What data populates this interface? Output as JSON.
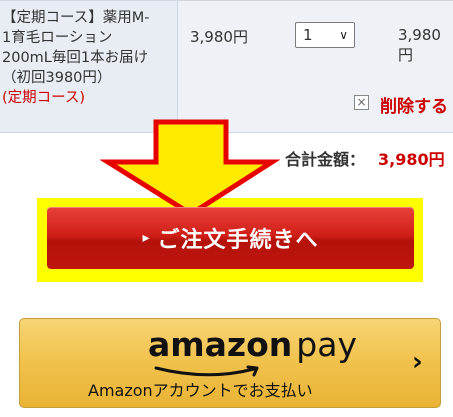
{
  "cart": {
    "item_name_lines": [
      "【定期コース】薬用M-",
      "1育毛ローション",
      "200mL毎回1本お届け",
      "（初回3980円）"
    ],
    "item_course": "(定期コース)",
    "unit_price": "3,980円",
    "quantity": "1",
    "subtotal": "3,980円",
    "delete_icon": "×",
    "delete_label": "削除する"
  },
  "total": {
    "label": "合計金額：",
    "value": "3,980円"
  },
  "checkout": {
    "play_icon": "▸",
    "label": "ご注文手続きへ",
    "highlight_color": "#ffff00",
    "arrow_color": "#ffeb00",
    "arrow_border_color": "#e60000"
  },
  "amazon_pay": {
    "logo_amazon": "amazon",
    "logo_pay": "pay",
    "subtitle": "Amazonアカウントでお支払い",
    "chevron": "›"
  }
}
